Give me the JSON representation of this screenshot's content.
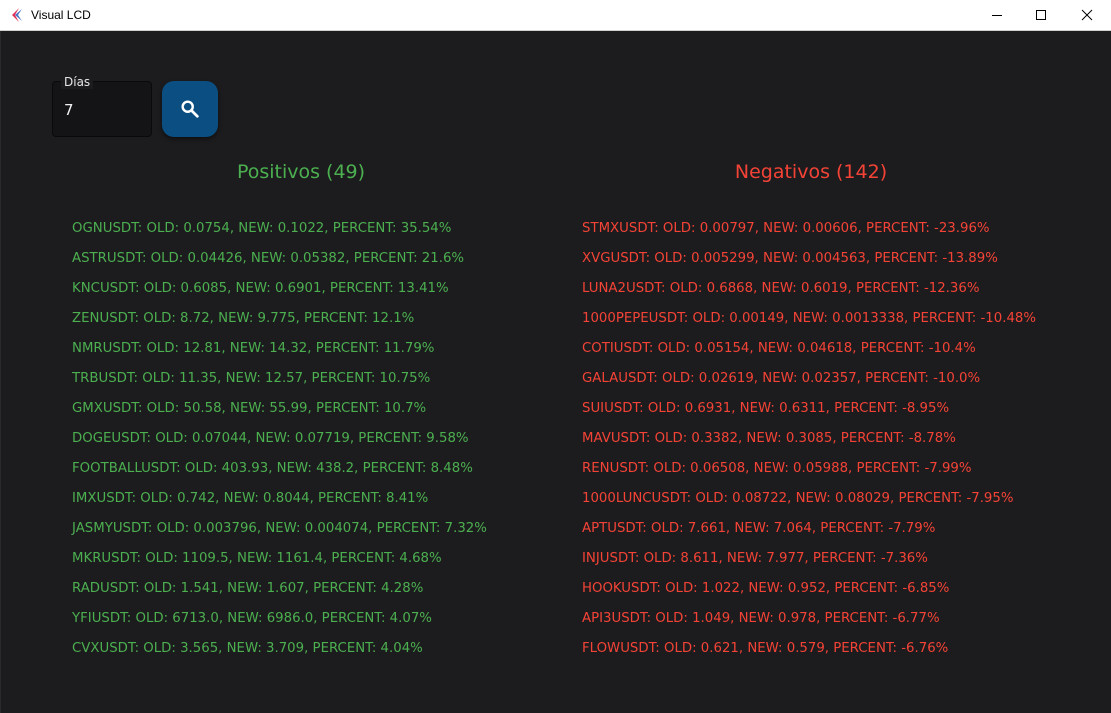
{
  "window": {
    "title": "Visual LCD",
    "icon": "flutter-logo-icon",
    "controls": [
      "minimize-icon",
      "maximize-icon",
      "close-icon"
    ]
  },
  "controls": {
    "days_label": "Días",
    "days_value": "7",
    "search_icon": "search-icon",
    "search_button_color": "#0b4f82"
  },
  "positives": {
    "title": "Positivos (49)",
    "color": "#4caf50",
    "items": [
      "OGNUSDT: OLD: 0.0754, NEW: 0.1022, PERCENT: 35.54%",
      "ASTRUSDT: OLD: 0.04426, NEW: 0.05382, PERCENT: 21.6%",
      "KNCUSDT: OLD: 0.6085, NEW: 0.6901, PERCENT: 13.41%",
      "ZENUSDT: OLD: 8.72, NEW: 9.775, PERCENT: 12.1%",
      "NMRUSDT: OLD: 12.81, NEW: 14.32, PERCENT: 11.79%",
      "TRBUSDT: OLD: 11.35, NEW: 12.57, PERCENT: 10.75%",
      "GMXUSDT: OLD: 50.58, NEW: 55.99, PERCENT: 10.7%",
      "DOGEUSDT: OLD: 0.07044, NEW: 0.07719, PERCENT: 9.58%",
      "FOOTBALLUSDT: OLD: 403.93, NEW: 438.2, PERCENT: 8.48%",
      "IMXUSDT: OLD: 0.742, NEW: 0.8044, PERCENT: 8.41%",
      "JASMYUSDT: OLD: 0.003796, NEW: 0.004074, PERCENT: 7.32%",
      "MKRUSDT: OLD: 1109.5, NEW: 1161.4, PERCENT: 4.68%",
      "RADUSDT: OLD: 1.541, NEW: 1.607, PERCENT: 4.28%",
      "YFIUSDT: OLD: 6713.0, NEW: 6986.0, PERCENT: 4.07%",
      "CVXUSDT: OLD: 3.565, NEW: 3.709, PERCENT: 4.04%"
    ]
  },
  "negatives": {
    "title": "Negativos (142)",
    "color": "#f44336",
    "items": [
      "STMXUSDT: OLD: 0.00797, NEW: 0.00606, PERCENT: -23.96%",
      "XVGUSDT: OLD: 0.005299, NEW: 0.004563, PERCENT: -13.89%",
      "LUNA2USDT: OLD: 0.6868, NEW: 0.6019, PERCENT: -12.36%",
      "1000PEPEUSDT: OLD: 0.00149, NEW: 0.0013338, PERCENT: -10.48%",
      "COTIUSDT: OLD: 0.05154, NEW: 0.04618, PERCENT: -10.4%",
      "GALAUSDT: OLD: 0.02619, NEW: 0.02357, PERCENT: -10.0%",
      "SUIUSDT: OLD: 0.6931, NEW: 0.6311, PERCENT: -8.95%",
      "MAVUSDT: OLD: 0.3382, NEW: 0.3085, PERCENT: -8.78%",
      "RENUSDT: OLD: 0.06508, NEW: 0.05988, PERCENT: -7.99%",
      "1000LUNCUSDT: OLD: 0.08722, NEW: 0.08029, PERCENT: -7.95%",
      "APTUSDT: OLD: 7.661, NEW: 7.064, PERCENT: -7.79%",
      "INJUSDT: OLD: 8.611, NEW: 7.977, PERCENT: -7.36%",
      "HOOKUSDT: OLD: 1.022, NEW: 0.952, PERCENT: -6.85%",
      "API3USDT: OLD: 1.049, NEW: 0.978, PERCENT: -6.77%",
      "FLOWUSDT: OLD: 0.621, NEW: 0.579, PERCENT: -6.76%"
    ]
  }
}
